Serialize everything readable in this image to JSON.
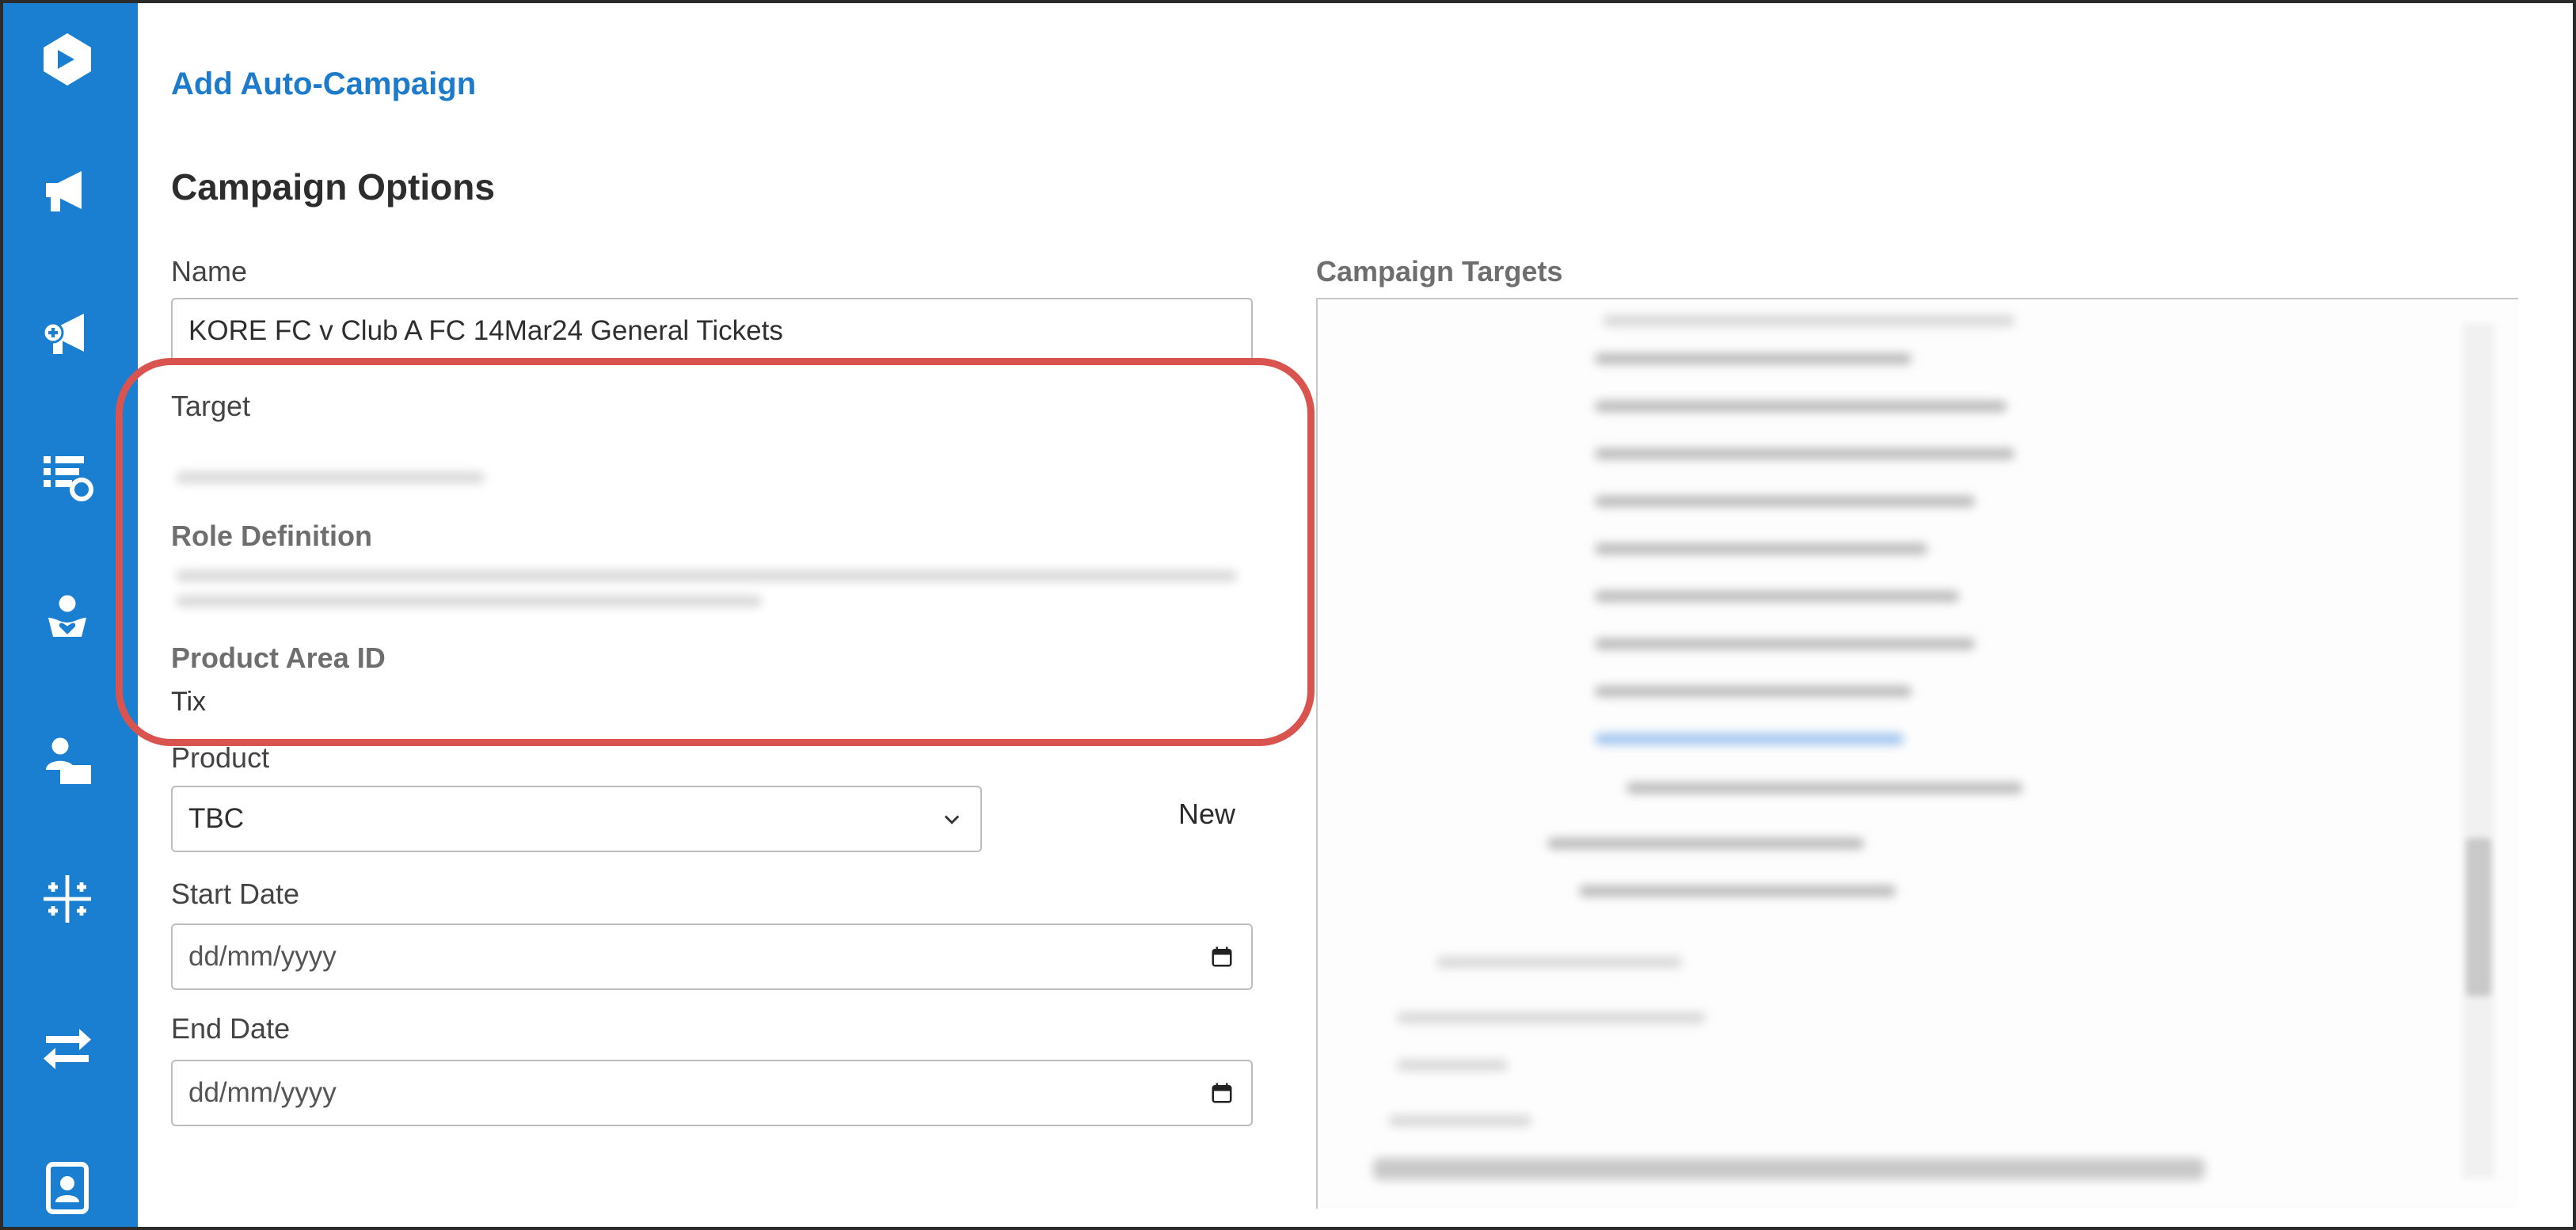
{
  "sidebar": {
    "items": [
      {
        "icon": "logo-cube-icon"
      },
      {
        "icon": "megaphone-icon"
      },
      {
        "icon": "megaphone-plus-icon"
      },
      {
        "icon": "list-settings-icon"
      },
      {
        "icon": "person-heart-icon"
      },
      {
        "icon": "person-box-icon"
      },
      {
        "icon": "sparkle-grid-icon"
      },
      {
        "icon": "transfer-arrows-icon"
      },
      {
        "icon": "contact-card-icon"
      }
    ],
    "color": "#1a7fd1"
  },
  "page": {
    "title": "Add Auto-Campaign",
    "section_title": "Campaign Options"
  },
  "form": {
    "name_label": "Name",
    "name_value": "KORE FC v Club A FC 14Mar24 General Tickets",
    "target_label": "Target",
    "role_definition_label": "Role Definition",
    "product_area_label": "Product Area ID",
    "product_area_value": "Tix",
    "product_label": "Product",
    "product_value": "TBC",
    "new_label": "New",
    "start_date_label": "Start Date",
    "start_date_placeholder": "dd/mm/yyyy",
    "end_date_label": "End Date",
    "end_date_placeholder": "dd/mm/yyyy"
  },
  "targets": {
    "label": "Campaign Targets"
  },
  "colors": {
    "accent": "#1d7bcc",
    "highlight": "#d9534f"
  }
}
